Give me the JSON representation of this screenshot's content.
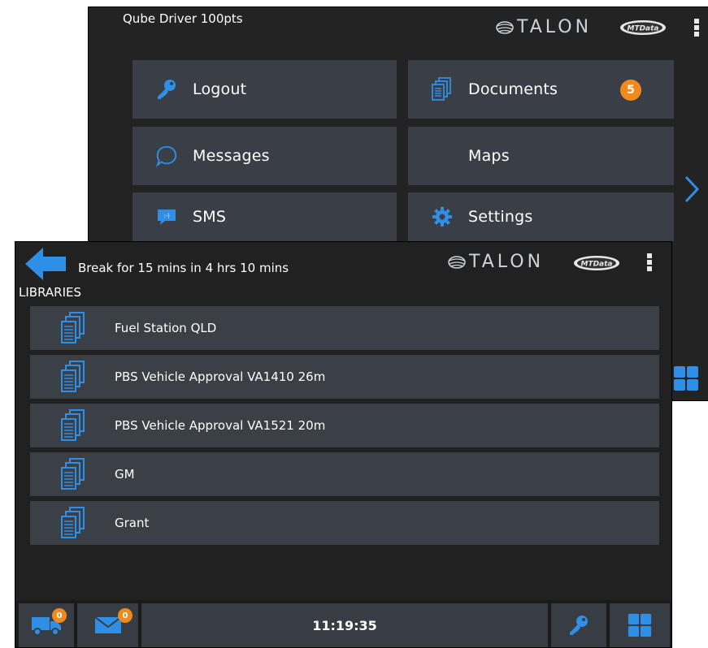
{
  "back_screen": {
    "title": "Qube Driver 100pts",
    "brand": "TALON",
    "brand2": "MTData",
    "menu": [
      {
        "label": "Logout",
        "icon": "key-icon"
      },
      {
        "label": "Documents",
        "icon": "documents-icon",
        "badge": "5"
      },
      {
        "label": "Messages",
        "icon": "speech-bubble-icon"
      },
      {
        "label": "Maps",
        "icon": ""
      },
      {
        "label": "SMS",
        "icon": "sms-icon"
      },
      {
        "label": "Settings",
        "icon": "gear-icon"
      }
    ]
  },
  "front_screen": {
    "header_text": "Break for 15 mins in 4 hrs 10 mins",
    "brand": "TALON",
    "brand2": "MTData",
    "section_title": "LIBRARIES",
    "libraries": [
      "Fuel Station QLD",
      "PBS Vehicle Approval VA1410 26m",
      "PBS Vehicle Approval VA1521 20m",
      "GM",
      "Grant"
    ],
    "bottom_bar": {
      "truck_badge": "0",
      "mail_badge": "0",
      "clock": "11:19:35"
    }
  },
  "colors": {
    "accent_blue": "#2f8fe6",
    "badge_orange": "#f08a1c",
    "panel": "#3b3f46",
    "background": "#212121"
  }
}
